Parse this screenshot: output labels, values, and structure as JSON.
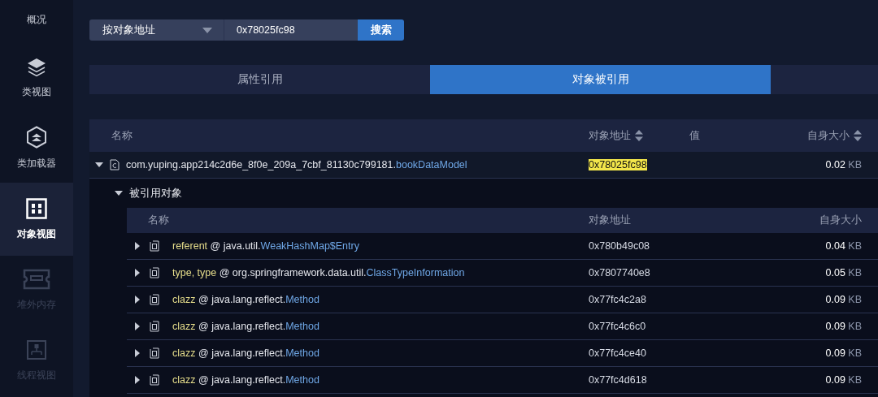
{
  "sidebar": {
    "items": [
      {
        "label": "概况",
        "selected": false,
        "disabled": false
      },
      {
        "label": "类视图",
        "selected": false,
        "disabled": false
      },
      {
        "label": "类加载器",
        "selected": false,
        "disabled": false
      },
      {
        "label": "对象视图",
        "selected": true,
        "disabled": false
      },
      {
        "label": "堆外内存",
        "selected": false,
        "disabled": true
      },
      {
        "label": "线程视图",
        "selected": false,
        "disabled": true
      }
    ]
  },
  "search": {
    "mode": "按对象地址",
    "value": "0x78025fc98",
    "button": "搜索"
  },
  "tabs": [
    {
      "label": "属性引用",
      "selected": false
    },
    {
      "label": "对象被引用",
      "selected": true
    }
  ],
  "table": {
    "columns": [
      {
        "label": "名称",
        "sortable": false
      },
      {
        "label": "对象地址",
        "sortable": true
      },
      {
        "label": "值",
        "sortable": false
      },
      {
        "label": "自身大小",
        "sortable": true
      }
    ],
    "root": {
      "expanded": true,
      "package": "com.yuping.app214c2d6e_8f0e_209a_7cbf_81130c799181.",
      "class_name": "bookDataModel",
      "address": "0x78025fc98",
      "highlighted": true,
      "size": "0.02",
      "unit": "KB"
    },
    "section": {
      "label": "被引用对象",
      "expanded": true,
      "columns": [
        {
          "label": "名称"
        },
        {
          "label": "对象地址"
        },
        {
          "label": "自身大小"
        }
      ],
      "rows": [
        {
          "expanded": false,
          "field": "referent",
          "package": "@ java.util.",
          "class_name": "WeakHashMap$Entry",
          "address": "0x780b49c08",
          "size": "0.04",
          "unit": "KB"
        },
        {
          "expanded": false,
          "field": "type, type",
          "package": "@ org.springframework.data.util.",
          "class_name": "ClassTypeInformation",
          "address": "0x7807740e8",
          "size": "0.05",
          "unit": "KB"
        },
        {
          "expanded": false,
          "field": "clazz",
          "package": "@ java.lang.reflect.",
          "class_name": "Method",
          "address": "0x77fc4c2a8",
          "size": "0.09",
          "unit": "KB"
        },
        {
          "expanded": false,
          "field": "clazz",
          "package": "@ java.lang.reflect.",
          "class_name": "Method",
          "address": "0x77fc4c6c0",
          "size": "0.09",
          "unit": "KB"
        },
        {
          "expanded": false,
          "field": "clazz",
          "package": "@ java.lang.reflect.",
          "class_name": "Method",
          "address": "0x77fc4ce40",
          "size": "0.09",
          "unit": "KB"
        },
        {
          "expanded": false,
          "field": "clazz",
          "package": "@ java.lang.reflect.",
          "class_name": "Method",
          "address": "0x77fc4d618",
          "size": "0.09",
          "unit": "KB"
        }
      ]
    }
  }
}
